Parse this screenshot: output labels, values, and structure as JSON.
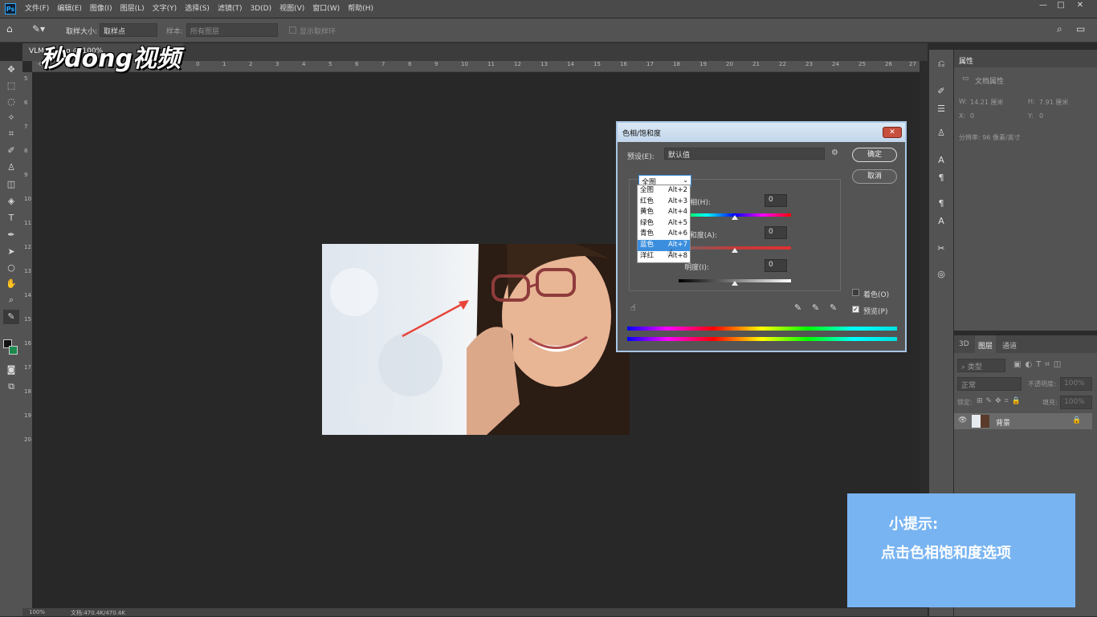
{
  "app": {
    "logo": "Ps"
  },
  "menu": [
    "文件(F)",
    "编辑(E)",
    "图像(I)",
    "图层(L)",
    "文字(Y)",
    "选择(S)",
    "滤镜(T)",
    "3D(D)",
    "视图(V)",
    "窗口(W)",
    "帮助(H)"
  ],
  "window_controls": {
    "minimize": "—",
    "restore": "□",
    "close": "✕"
  },
  "options": {
    "sample_size_label": "取样大小:",
    "sample_size_value": "取样点",
    "sample_label": "样本:",
    "sample_value": "所有图层",
    "show_ring": "显示取样环"
  },
  "doc_tab": {
    "title": "VLM_10.jpg @ 100%"
  },
  "watermark": "秒dong视频",
  "hruler": [
    "-6",
    "-5",
    "-4",
    "-3",
    "-2",
    "-1",
    "0",
    "1",
    "2",
    "3",
    "4",
    "5",
    "6",
    "7",
    "8",
    "9",
    "10",
    "11",
    "12",
    "13",
    "14",
    "15",
    "16",
    "17",
    "18",
    "19",
    "20",
    "21",
    "22",
    "23",
    "24",
    "25",
    "26",
    "27"
  ],
  "vruler": [
    "5",
    "6",
    "7",
    "8",
    "9",
    "10",
    "11",
    "12",
    "13",
    "14",
    "15",
    "16",
    "17",
    "18",
    "19",
    "20"
  ],
  "status": {
    "zoom": "100%",
    "doc": "文档:470.4K/470.4K"
  },
  "properties": {
    "tab": "属性",
    "section": "文档属性",
    "w_label": "W:",
    "w_value": "14.21 厘米",
    "h_label": "H:",
    "h_value": "7.91 厘米",
    "x_label": "X:",
    "x_value": "0",
    "y_label": "Y:",
    "y_value": "0",
    "resolution": "分辨率: 96 像素/英寸"
  },
  "layers": {
    "tabs": [
      "3D",
      "图层",
      "通道"
    ],
    "filter": "类型",
    "blend": "正常",
    "opacity_label": "不透明度:",
    "opacity_value": "100%",
    "lock_label": "锁定:",
    "fill_label": "填充:",
    "fill_value": "100%",
    "layer_name": "背景"
  },
  "dialog": {
    "title": "色相/饱和度",
    "close": "✕",
    "preset_label": "预设(E):",
    "preset_value": "默认值",
    "ok": "确定",
    "cancel": "取消",
    "channel_selected": "全图",
    "hue_label": "色相(H):",
    "hue_value": "0",
    "sat_label": "饱和度(A):",
    "sat_value": "0",
    "light_label": "明度(I):",
    "light_value": "0",
    "colorize": "着色(O)",
    "preview": "预览(P)",
    "dropdown": [
      {
        "name": "全图",
        "key": "Alt+2"
      },
      {
        "name": "红色",
        "key": "Alt+3"
      },
      {
        "name": "黄色",
        "key": "Alt+4"
      },
      {
        "name": "绿色",
        "key": "Alt+5"
      },
      {
        "name": "青色",
        "key": "Alt+6"
      },
      {
        "name": "蓝色",
        "key": "Alt+7"
      },
      {
        "name": "洋红",
        "key": "Alt+8"
      }
    ]
  },
  "tip": {
    "title": "小提示:",
    "text": "点击色相饱和度选项"
  }
}
